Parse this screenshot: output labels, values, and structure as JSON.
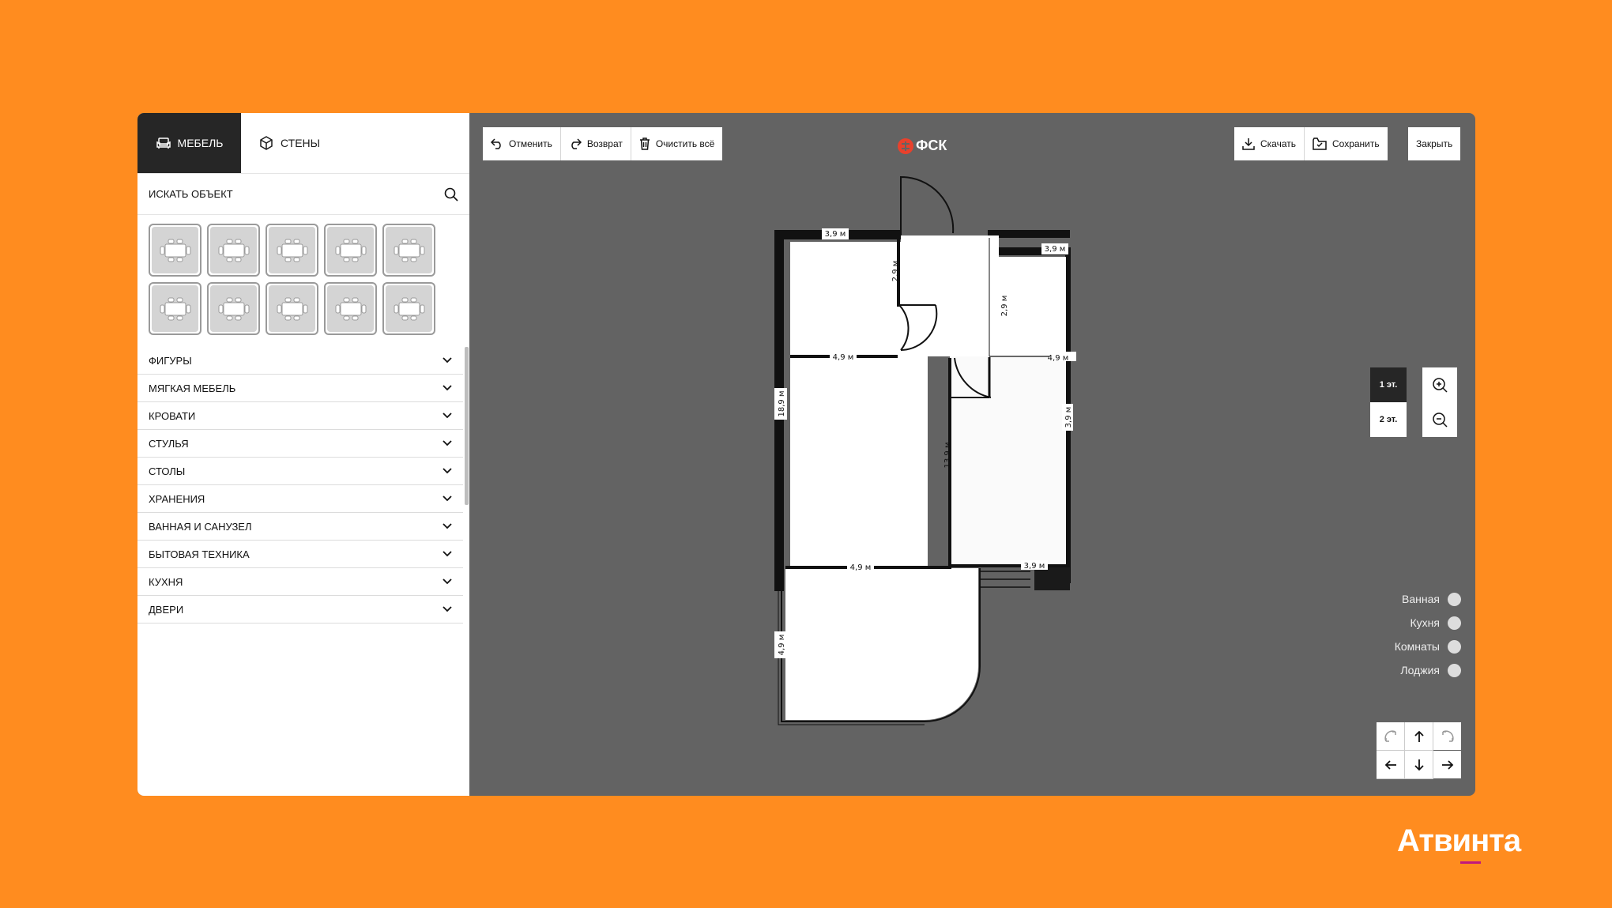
{
  "sidebar": {
    "tabs": [
      {
        "label": "Мебель",
        "icon": "sofa-icon",
        "active": true
      },
      {
        "label": "Стены",
        "icon": "cube-icon",
        "active": false
      }
    ],
    "search": {
      "placeholder": "Искать объект"
    },
    "thumbnails": [
      "table-chairs",
      "table-chairs",
      "table-chairs",
      "table-chairs",
      "table-chairs",
      "table-chairs",
      "table-chairs",
      "table-chairs",
      "table-chairs",
      "table-chairs"
    ],
    "categories": [
      "Фигуры",
      "Мягкая мебель",
      "Кровати",
      "Стулья",
      "Столы",
      "Хранения",
      "Ванная и санузел",
      "Бытовая техника",
      "Кухня",
      "Двери"
    ]
  },
  "toolbar": {
    "undo": "Отменить",
    "redo": "Возврат",
    "clear": "Очистить всё",
    "download": "Скачать",
    "save": "Сохранить",
    "close": "Закрыть"
  },
  "logo": "ФСК",
  "floors": {
    "first": "1 эт.",
    "second": "2 эт."
  },
  "legend": [
    "Ванная",
    "Кухня",
    "Комнаты",
    "Лоджия"
  ],
  "plan": {
    "dims": [
      "3,9 м",
      "3,9 м",
      "2,9 м",
      "2,9 м",
      "4,9 м",
      "4,9 м",
      "18,9 м",
      "13,9 м",
      "3,9 м",
      "4,9 м",
      "3,9 м",
      "4,9 м"
    ]
  },
  "brand": "Атвинта",
  "colors": {
    "background": "#FF8C1F",
    "canvas": "#636363",
    "active_tab": "#262626",
    "brand_accent": "#c0187e",
    "logo_red": "#E8412C"
  }
}
